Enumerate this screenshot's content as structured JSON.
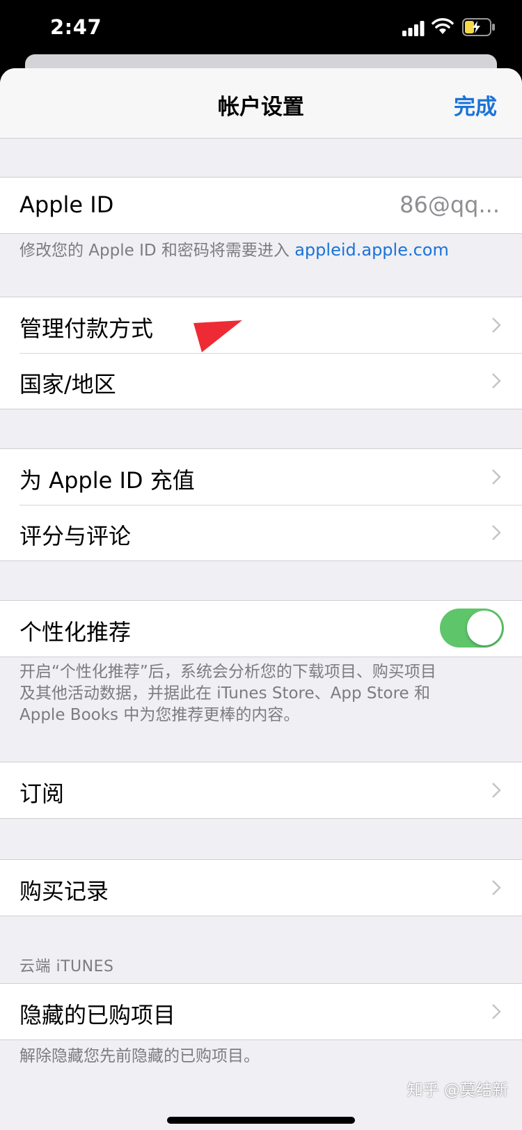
{
  "status": {
    "time": "2:47"
  },
  "nav": {
    "title": "帐户设置",
    "done": "完成"
  },
  "apple_id": {
    "label": "Apple ID",
    "value": "86@qq...",
    "footer_text": "修改您的 Apple ID 和密码将需要进入 ",
    "footer_link": "appleid.apple.com"
  },
  "payment_group": {
    "manage_payment": "管理付款方式",
    "region": "国家/地区"
  },
  "topup_group": {
    "topup": "为 Apple ID 充值",
    "ratings": "评分与评论"
  },
  "personalized": {
    "label": "个性化推荐",
    "enabled": true,
    "footer_line1": "开启“个性化推荐”后，系统会分析您的下载项目、购买项目",
    "footer_line2": "及其他活动数据，并据此在 iTunes Store、App Store 和",
    "footer_line3": "Apple Books 中为您推荐更棒的内容。"
  },
  "subscriptions": {
    "label": "订阅"
  },
  "purchase_history": {
    "label": "购买记录"
  },
  "cloud_itunes": {
    "header": "云端 iTUNES",
    "hidden_purchases": "隐藏的已购项目",
    "footer": "解除隐藏您先前隐藏的已购项目。"
  },
  "watermark": "知乎 @莫结新",
  "colors": {
    "accent": "#1a73d8",
    "toggle_on": "#5ec56b",
    "pointer": "#ee2b35"
  }
}
